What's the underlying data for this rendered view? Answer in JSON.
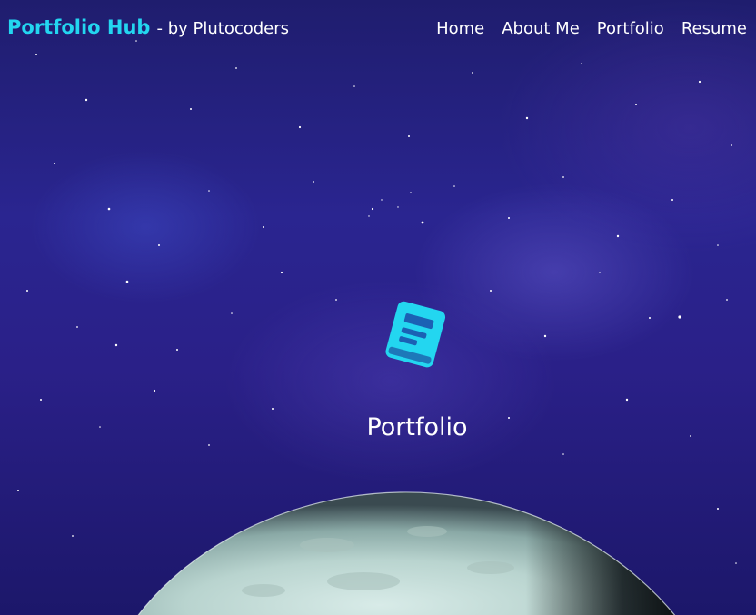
{
  "brand": {
    "name": "Portfolio Hub",
    "byline": "- by Plutocoders"
  },
  "nav": {
    "links": [
      "Home",
      "About Me",
      "Portfolio",
      "Resume"
    ]
  },
  "hero": {
    "icon": "book-icon",
    "title": "Portfolio"
  },
  "colors": {
    "accent": "#23d6f0",
    "background": "#2a2590",
    "text": "#ffffff"
  }
}
